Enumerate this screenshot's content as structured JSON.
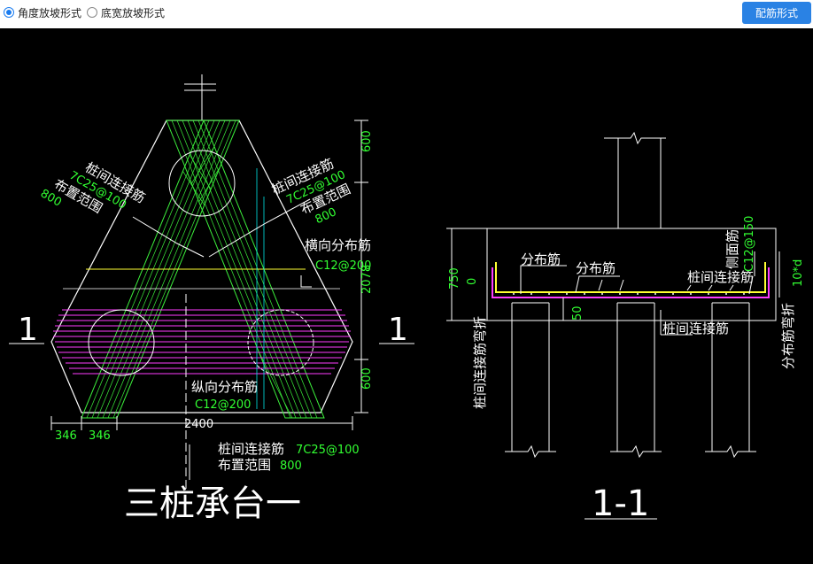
{
  "toolbar": {
    "radio_angle_label": "角度放坡形式",
    "radio_width_label": "底宽放坡形式",
    "selected": "angle",
    "config_button_label": "配筋形式"
  },
  "plan": {
    "title": "三桩承台一",
    "section_mark_left": "1",
    "section_mark_right": "1",
    "left_label": "桩间连接筋",
    "left_spec": "7C25@100",
    "left_range_label": "布置范围",
    "left_range_value": "800",
    "right_label": "桩间连接筋",
    "right_spec": "7C25@100",
    "right_range_label": "布置范围",
    "right_range_value": "800",
    "trans_label": "横向分布筋",
    "trans_spec": "C12@200",
    "long_label": "纵向分布筋",
    "long_spec": "C12@200",
    "bottom_label": "桩间连接筋",
    "bottom_spec": "7C25@100",
    "bottom_range_label": "布置范围",
    "bottom_range_value": "800",
    "dim_v1": "600",
    "dim_v2": "2078",
    "dim_v3": "600",
    "dim_h1": "346",
    "dim_h2": "346",
    "dim_h3": "2400"
  },
  "section": {
    "title": "1-1",
    "dist_label_1": "分布筋",
    "dist_label_2": "分布筋",
    "side_label": "侧面筋",
    "side_spec": "C12@150",
    "conn_label_1": "桩间连接筋",
    "conn_label_2": "桩间连接筋",
    "conn_bend_label": "桩间连接筋弯折",
    "dist_bend_label": "分布筋弯折",
    "dist_bend_value": "10*d",
    "dim_750": "750",
    "dim_0": "0",
    "dim_50": "50"
  },
  "colors": {
    "outline": "#ffffff",
    "rebar_green": "#3cf03c",
    "rebar_magenta": "#ff3cff",
    "rebar_yellow": "#ffff32",
    "dim_green": "#32ff32",
    "cyan": "#00e5e5",
    "accent_blue": "#2a82e4"
  }
}
